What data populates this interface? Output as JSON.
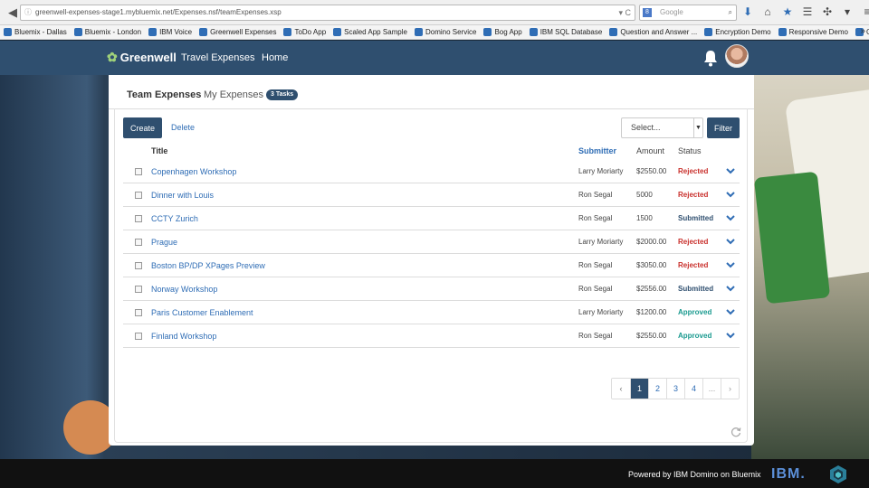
{
  "browser": {
    "url": "greenwell-expenses-stage1.mybluemix.net/Expenses.nsf/teamExpenses.xsp",
    "search_placeholder": "Google",
    "bookmarks": [
      "Bluemix - Dallas",
      "Bluemix - London",
      "IBM Voice",
      "Greenwell Expenses",
      "ToDo App",
      "Scaled App Sample",
      "Domino Service",
      "Bog App",
      "IBM SQL Database",
      "Question and Answer ...",
      "Encryption Demo",
      "Responsive Demo",
      "Greenwell"
    ]
  },
  "header": {
    "brand": "Greenwell",
    "nav": [
      "Travel Expenses",
      "Home"
    ],
    "accent": "#2f4f6f"
  },
  "tabs": {
    "team": "Team Expenses",
    "my": "My Expenses",
    "badge": "3 Tasks"
  },
  "toolbar": {
    "create": "Create",
    "delete": "Delete",
    "select": "Select...",
    "filter": "Filter"
  },
  "table": {
    "headers": {
      "title": "Title",
      "submitter": "Submitter",
      "amount": "Amount",
      "status": "Status"
    },
    "rows": [
      {
        "title": "Copenhagen Workshop",
        "submitter": "Larry Moriarty",
        "amount": "$2550.00",
        "status": "Rejected"
      },
      {
        "title": "Dinner with Louis",
        "submitter": "Ron Segal",
        "amount": "5000",
        "status": "Rejected"
      },
      {
        "title": "CCTY Zurich",
        "submitter": "Ron Segal",
        "amount": "1500",
        "status": "Submitted"
      },
      {
        "title": "Prague",
        "submitter": "Larry Moriarty",
        "amount": "$2000.00",
        "status": "Rejected"
      },
      {
        "title": "Boston BP/DP XPages Preview",
        "submitter": "Ron Segal",
        "amount": "$3050.00",
        "status": "Rejected"
      },
      {
        "title": "Norway Workshop",
        "submitter": "Ron Segal",
        "amount": "$2556.00",
        "status": "Submitted"
      },
      {
        "title": "Paris Customer Enablement",
        "submitter": "Larry Moriarty",
        "amount": "$1200.00",
        "status": "Approved"
      },
      {
        "title": "Finland Workshop",
        "submitter": "Ron Segal",
        "amount": "$2550.00",
        "status": "Approved"
      }
    ],
    "status_colors": {
      "Rejected": "#c9302c",
      "Submitted": "#2f4f6f",
      "Approved": "#1a9a8f"
    }
  },
  "pagination": {
    "prev": "‹",
    "pages": [
      "1",
      "2",
      "3",
      "4"
    ],
    "ellipsis": "...",
    "next": "›",
    "current": "1"
  },
  "footer": {
    "powered": "Powered by IBM Domino on Bluemix",
    "ibm": "IBM."
  }
}
